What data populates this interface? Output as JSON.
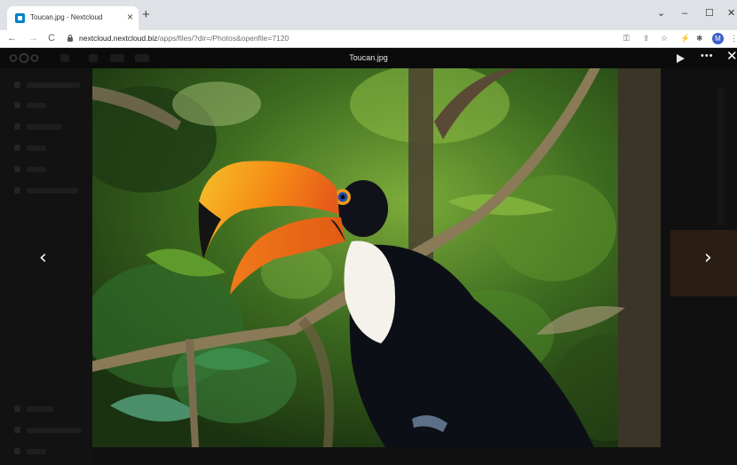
{
  "browser": {
    "tab_title": "Toucan.jpg - Nextcloud",
    "tab_close": "×",
    "new_tab": "+",
    "window_controls": {
      "collapse": "⌄",
      "minimize": "–",
      "maximize": "☐",
      "close": "✕"
    },
    "nav": {
      "back": "←",
      "forward": "→",
      "reload": "C"
    },
    "url_host": "nextcloud.nextcloud.biz",
    "url_path": "/apps/files/?dir=/Photos&openfile=7120",
    "toolbar_icons": [
      "key-icon",
      "share-icon",
      "star-icon",
      "extension-bolt-icon",
      "puzzle-icon"
    ],
    "profile_initial": "M",
    "profile_color": "#3b5fc9"
  },
  "viewer": {
    "title": "Toucan.jpg",
    "prev_arrow": "‹",
    "next_arrow": "›",
    "actions": [
      "play-slideshow",
      "more-actions",
      "close-viewer"
    ],
    "close_label": "✕",
    "more_label": "•••",
    "background": "#101010"
  },
  "accent": "#0082c9"
}
